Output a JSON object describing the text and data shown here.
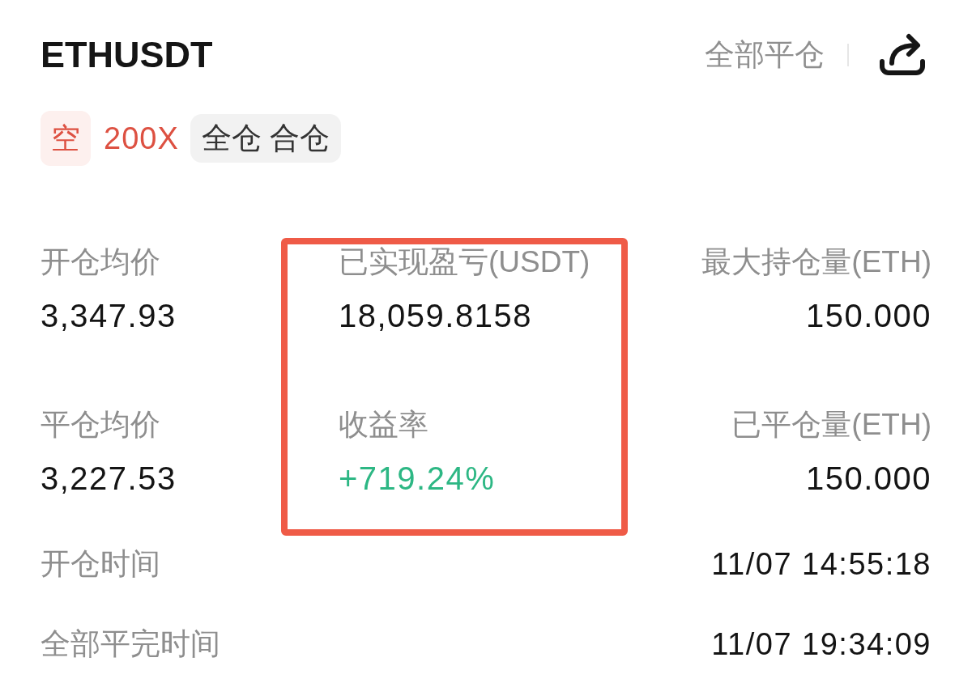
{
  "header": {
    "symbol": "ETHUSDT",
    "close_all": "全部平仓"
  },
  "tags": [
    {
      "kind": "side",
      "text": "空"
    },
    {
      "kind": "leverage",
      "text": "200X"
    },
    {
      "kind": "mode",
      "text": "全仓 合仓"
    }
  ],
  "stat_columns": [
    {
      "highlighted": false,
      "items": [
        {
          "label": "开仓均价",
          "value": "3,347.93",
          "kind": "plain"
        },
        {
          "label": "平仓均价",
          "value": "3,227.53",
          "kind": "plain"
        }
      ]
    },
    {
      "highlighted": true,
      "items": [
        {
          "label": "已实现盈亏(USDT)",
          "value": "18,059.8158",
          "kind": "plain"
        },
        {
          "label": "收益率",
          "value": "+719.24%",
          "kind": "gain"
        }
      ]
    },
    {
      "highlighted": false,
      "items": [
        {
          "label": "最大持仓量(ETH)",
          "value": "150.000",
          "kind": "plain"
        },
        {
          "label": "已平仓量(ETH)",
          "value": "150.000",
          "kind": "plain"
        }
      ]
    }
  ],
  "times": [
    {
      "label": "开仓时间",
      "value": "11/07 14:55:18"
    },
    {
      "label": "全部平完时间",
      "value": "11/07 19:34:09"
    }
  ]
}
